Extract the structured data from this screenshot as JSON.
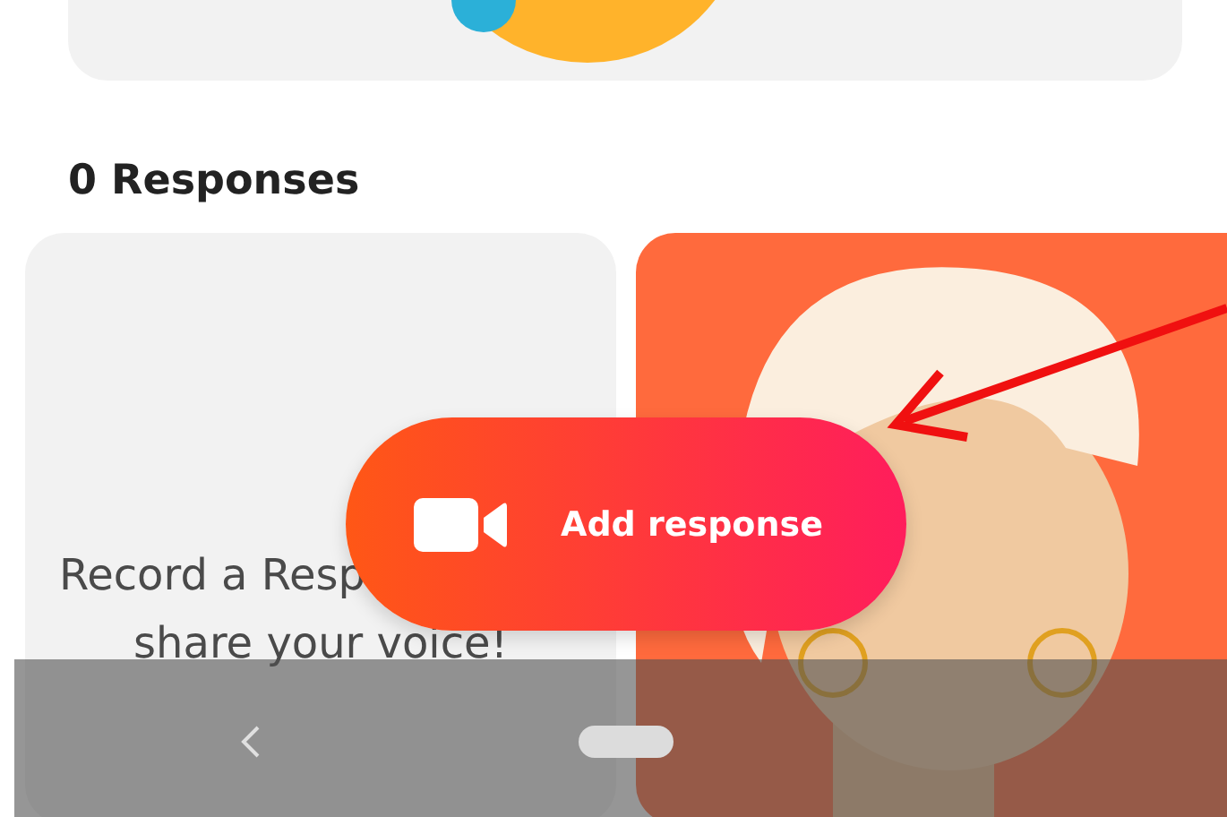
{
  "top_card": {
    "kind": "picture"
  },
  "heading": "0 Responses",
  "cards": [
    {
      "kind": "prompt",
      "lines": [
        "Record a Resp",
        "share your voice!"
      ]
    },
    {
      "kind": "picture"
    }
  ],
  "fab": {
    "label": "Add response"
  }
}
